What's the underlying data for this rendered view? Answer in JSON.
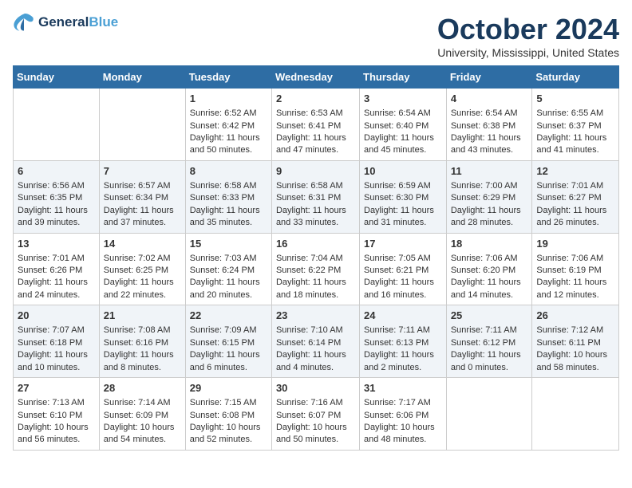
{
  "header": {
    "logo_line1": "General",
    "logo_line2": "Blue",
    "month": "October 2024",
    "location": "University, Mississippi, United States"
  },
  "weekdays": [
    "Sunday",
    "Monday",
    "Tuesday",
    "Wednesday",
    "Thursday",
    "Friday",
    "Saturday"
  ],
  "weeks": [
    [
      {
        "day": "",
        "content": ""
      },
      {
        "day": "",
        "content": ""
      },
      {
        "day": "1",
        "content": "Sunrise: 6:52 AM\nSunset: 6:42 PM\nDaylight: 11 hours and 50 minutes."
      },
      {
        "day": "2",
        "content": "Sunrise: 6:53 AM\nSunset: 6:41 PM\nDaylight: 11 hours and 47 minutes."
      },
      {
        "day": "3",
        "content": "Sunrise: 6:54 AM\nSunset: 6:40 PM\nDaylight: 11 hours and 45 minutes."
      },
      {
        "day": "4",
        "content": "Sunrise: 6:54 AM\nSunset: 6:38 PM\nDaylight: 11 hours and 43 minutes."
      },
      {
        "day": "5",
        "content": "Sunrise: 6:55 AM\nSunset: 6:37 PM\nDaylight: 11 hours and 41 minutes."
      }
    ],
    [
      {
        "day": "6",
        "content": "Sunrise: 6:56 AM\nSunset: 6:35 PM\nDaylight: 11 hours and 39 minutes."
      },
      {
        "day": "7",
        "content": "Sunrise: 6:57 AM\nSunset: 6:34 PM\nDaylight: 11 hours and 37 minutes."
      },
      {
        "day": "8",
        "content": "Sunrise: 6:58 AM\nSunset: 6:33 PM\nDaylight: 11 hours and 35 minutes."
      },
      {
        "day": "9",
        "content": "Sunrise: 6:58 AM\nSunset: 6:31 PM\nDaylight: 11 hours and 33 minutes."
      },
      {
        "day": "10",
        "content": "Sunrise: 6:59 AM\nSunset: 6:30 PM\nDaylight: 11 hours and 31 minutes."
      },
      {
        "day": "11",
        "content": "Sunrise: 7:00 AM\nSunset: 6:29 PM\nDaylight: 11 hours and 28 minutes."
      },
      {
        "day": "12",
        "content": "Sunrise: 7:01 AM\nSunset: 6:27 PM\nDaylight: 11 hours and 26 minutes."
      }
    ],
    [
      {
        "day": "13",
        "content": "Sunrise: 7:01 AM\nSunset: 6:26 PM\nDaylight: 11 hours and 24 minutes."
      },
      {
        "day": "14",
        "content": "Sunrise: 7:02 AM\nSunset: 6:25 PM\nDaylight: 11 hours and 22 minutes."
      },
      {
        "day": "15",
        "content": "Sunrise: 7:03 AM\nSunset: 6:24 PM\nDaylight: 11 hours and 20 minutes."
      },
      {
        "day": "16",
        "content": "Sunrise: 7:04 AM\nSunset: 6:22 PM\nDaylight: 11 hours and 18 minutes."
      },
      {
        "day": "17",
        "content": "Sunrise: 7:05 AM\nSunset: 6:21 PM\nDaylight: 11 hours and 16 minutes."
      },
      {
        "day": "18",
        "content": "Sunrise: 7:06 AM\nSunset: 6:20 PM\nDaylight: 11 hours and 14 minutes."
      },
      {
        "day": "19",
        "content": "Sunrise: 7:06 AM\nSunset: 6:19 PM\nDaylight: 11 hours and 12 minutes."
      }
    ],
    [
      {
        "day": "20",
        "content": "Sunrise: 7:07 AM\nSunset: 6:18 PM\nDaylight: 11 hours and 10 minutes."
      },
      {
        "day": "21",
        "content": "Sunrise: 7:08 AM\nSunset: 6:16 PM\nDaylight: 11 hours and 8 minutes."
      },
      {
        "day": "22",
        "content": "Sunrise: 7:09 AM\nSunset: 6:15 PM\nDaylight: 11 hours and 6 minutes."
      },
      {
        "day": "23",
        "content": "Sunrise: 7:10 AM\nSunset: 6:14 PM\nDaylight: 11 hours and 4 minutes."
      },
      {
        "day": "24",
        "content": "Sunrise: 7:11 AM\nSunset: 6:13 PM\nDaylight: 11 hours and 2 minutes."
      },
      {
        "day": "25",
        "content": "Sunrise: 7:11 AM\nSunset: 6:12 PM\nDaylight: 11 hours and 0 minutes."
      },
      {
        "day": "26",
        "content": "Sunrise: 7:12 AM\nSunset: 6:11 PM\nDaylight: 10 hours and 58 minutes."
      }
    ],
    [
      {
        "day": "27",
        "content": "Sunrise: 7:13 AM\nSunset: 6:10 PM\nDaylight: 10 hours and 56 minutes."
      },
      {
        "day": "28",
        "content": "Sunrise: 7:14 AM\nSunset: 6:09 PM\nDaylight: 10 hours and 54 minutes."
      },
      {
        "day": "29",
        "content": "Sunrise: 7:15 AM\nSunset: 6:08 PM\nDaylight: 10 hours and 52 minutes."
      },
      {
        "day": "30",
        "content": "Sunrise: 7:16 AM\nSunset: 6:07 PM\nDaylight: 10 hours and 50 minutes."
      },
      {
        "day": "31",
        "content": "Sunrise: 7:17 AM\nSunset: 6:06 PM\nDaylight: 10 hours and 48 minutes."
      },
      {
        "day": "",
        "content": ""
      },
      {
        "day": "",
        "content": ""
      }
    ]
  ]
}
